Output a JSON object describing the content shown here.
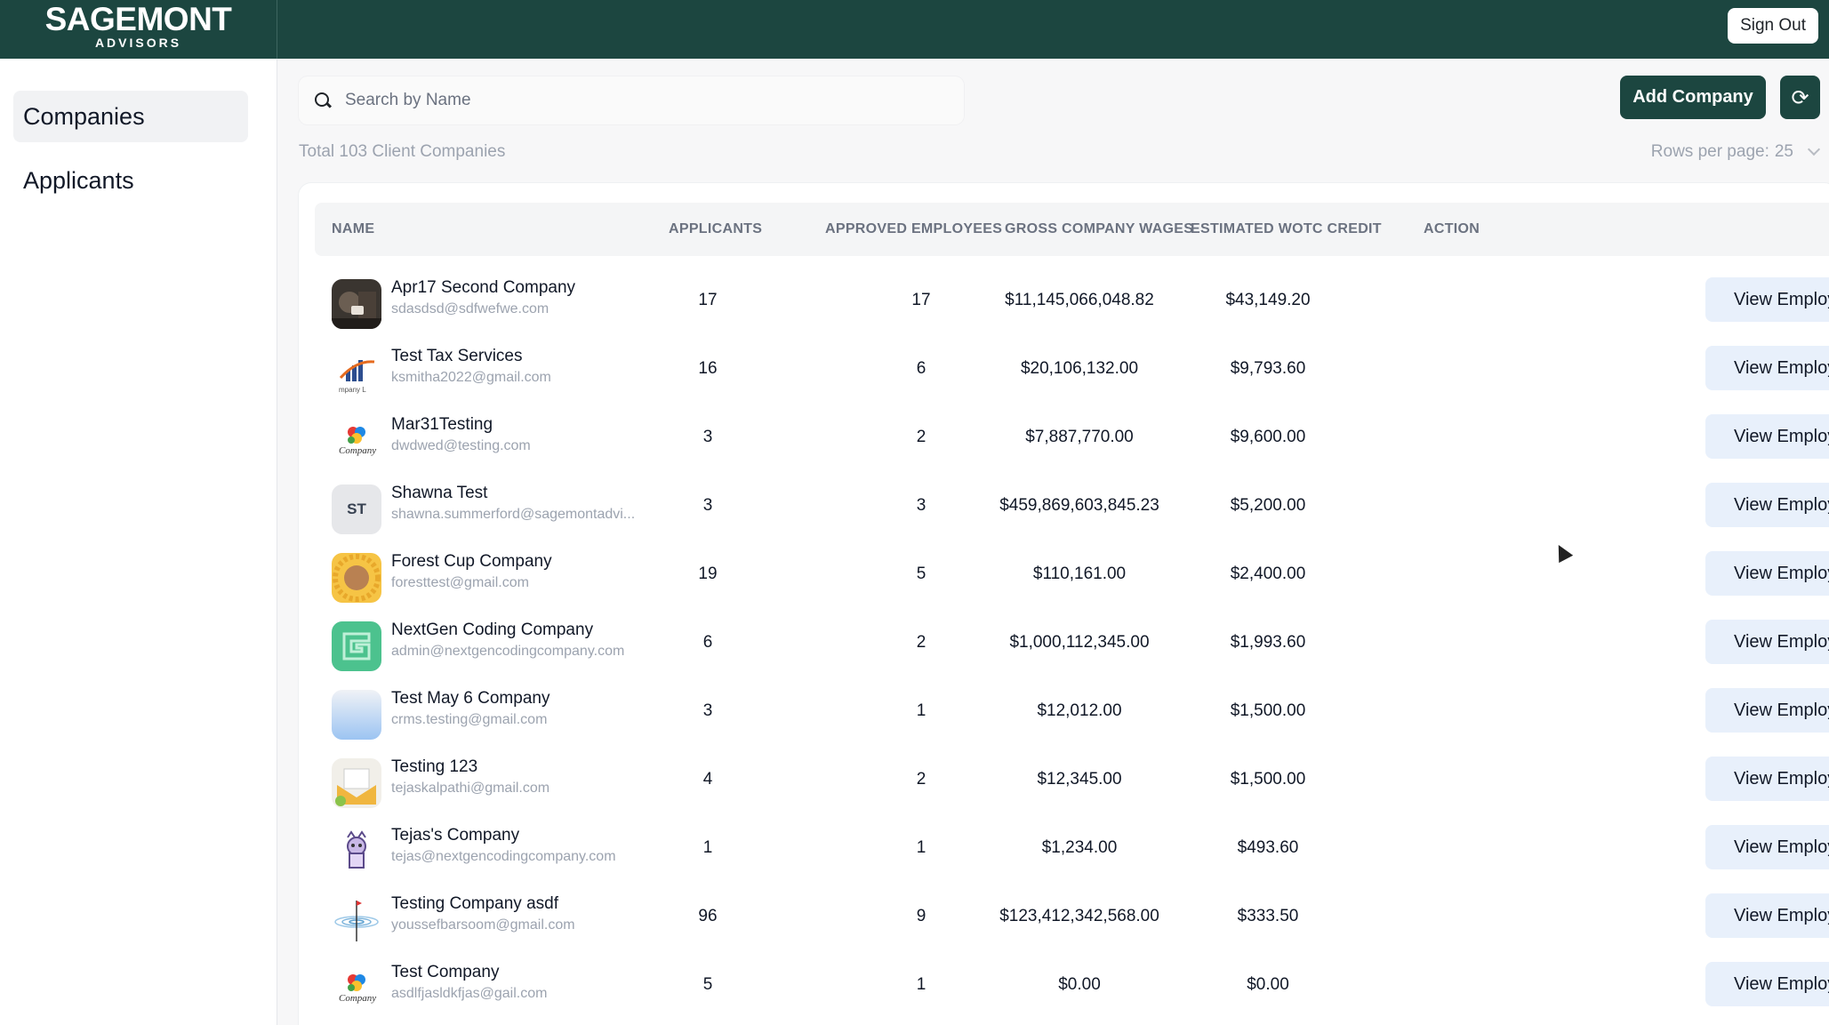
{
  "header": {
    "logo_main": "SAGEMONT",
    "logo_sub": "ADVISORS",
    "sign_out_label": "Sign Out",
    "color": "#1c4640"
  },
  "sidebar": {
    "items": [
      {
        "label": "Companies",
        "active": true
      },
      {
        "label": "Applicants",
        "active": false
      }
    ]
  },
  "toolbar": {
    "search_placeholder": "Search by Name",
    "search_value": "",
    "add_company_label": "Add Company",
    "refresh_icon": "refresh-icon"
  },
  "summary": {
    "total_text": "Total 103 Client Companies",
    "rows_per_page_label": "Rows per page:",
    "rows_per_page_value": "25"
  },
  "table": {
    "headers": {
      "name": "NAME",
      "applicants": "APPLICANTS",
      "approved": "APPROVED EMPLOYEES",
      "wages": "GROSS COMPANY WAGES",
      "credit": "ESTIMATED WOTC CREDIT",
      "action": "ACTION"
    },
    "action_label": "View Employees",
    "rows": [
      {
        "name": "Apr17 Second Company",
        "email": "sdasdsd@sdfwefwe.com",
        "applicants": "17",
        "approved": "17",
        "wages": "$11,145,066,048.82",
        "credit": "$43,149.20",
        "avatar": "photo"
      },
      {
        "name": "Test Tax Services",
        "email": "ksmitha2022@gmail.com",
        "applicants": "16",
        "approved": "6",
        "wages": "$20,106,132.00",
        "credit": "$9,793.60",
        "avatar": "chart-logo"
      },
      {
        "name": "Mar31Testing",
        "email": "dwdwed@testing.com",
        "applicants": "3",
        "approved": "2",
        "wages": "$7,887,770.00",
        "credit": "$9,600.00",
        "avatar": "company-logo"
      },
      {
        "name": "Shawna Test",
        "email": "shawna.summerford@sagemontadvi...",
        "applicants": "3",
        "approved": "3",
        "wages": "$459,869,603,845.23",
        "credit": "$5,200.00",
        "avatar": "initials",
        "initials": "ST"
      },
      {
        "name": "Forest Cup Company",
        "email": "foresttest@gmail.com",
        "applicants": "19",
        "approved": "5",
        "wages": "$110,161.00",
        "credit": "$2,400.00",
        "avatar": "sun"
      },
      {
        "name": "NextGen Coding Company",
        "email": "admin@nextgencodingcompany.com",
        "applicants": "6",
        "approved": "2",
        "wages": "$1,000,112,345.00",
        "credit": "$1,993.60",
        "avatar": "g-logo"
      },
      {
        "name": "Test May 6 Company",
        "email": "crms.testing@gmail.com",
        "applicants": "3",
        "approved": "1",
        "wages": "$12,012.00",
        "credit": "$1,500.00",
        "avatar": "gradient"
      },
      {
        "name": "Testing 123",
        "email": "tejaskalpathi@gmail.com",
        "applicants": "4",
        "approved": "2",
        "wages": "$12,345.00",
        "credit": "$1,500.00",
        "avatar": "envelope"
      },
      {
        "name": "Tejas's Company",
        "email": "tejas@nextgencodingcompany.com",
        "applicants": "1",
        "approved": "1",
        "wages": "$1,234.00",
        "credit": "$493.60",
        "avatar": "mascot"
      },
      {
        "name": "Testing Company asdf",
        "email": "youssefbarsoom@gmail.com",
        "applicants": "96",
        "approved": "9",
        "wages": "$123,412,342,568.00",
        "credit": "$333.50",
        "avatar": "ripple"
      },
      {
        "name": "Test Company",
        "email": "asdlfjasldkfjas@gail.com",
        "applicants": "5",
        "approved": "1",
        "wages": "$0.00",
        "credit": "$0.00",
        "avatar": "company-logo"
      }
    ]
  }
}
